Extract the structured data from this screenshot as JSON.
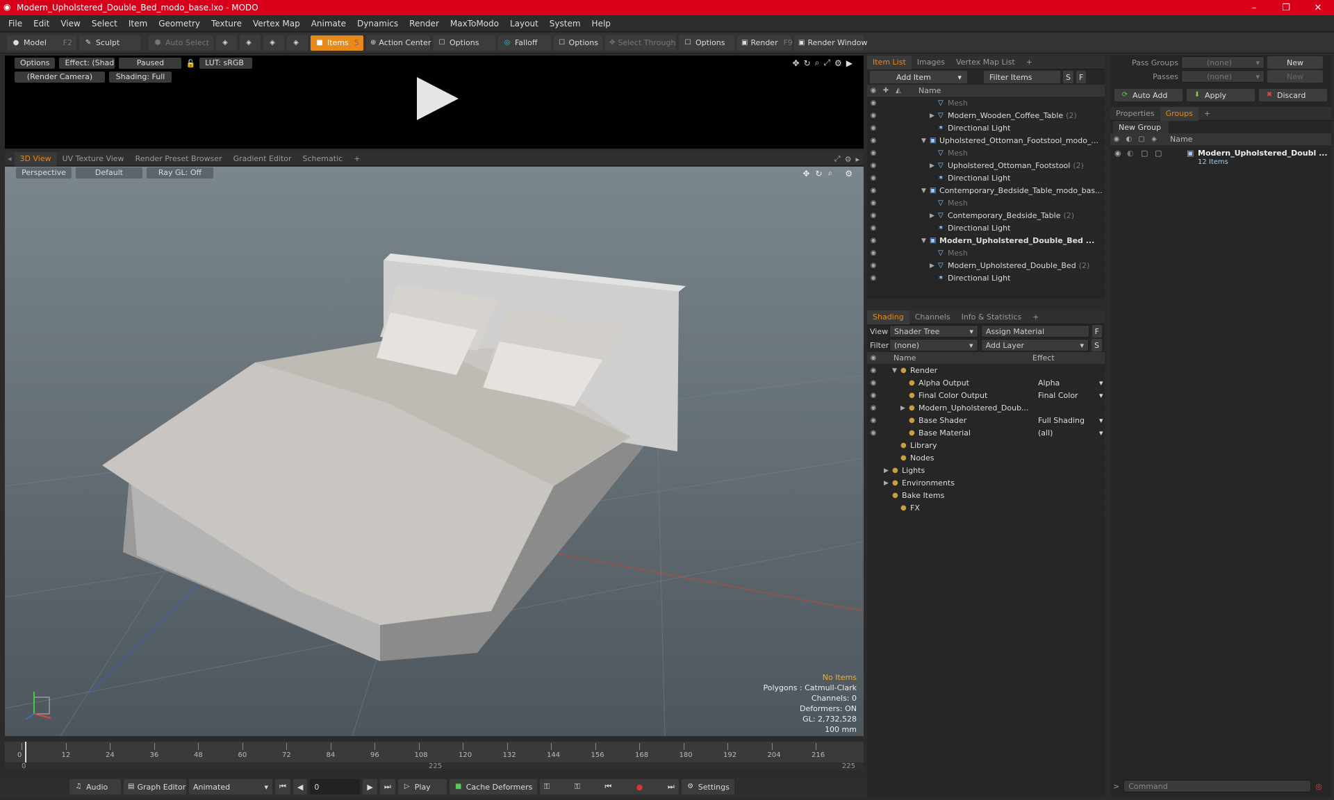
{
  "window": {
    "title": "Modern_Upholstered_Double_Bed_modo_base.lxo - MODO",
    "minimize": "–",
    "maximize": "❐",
    "close": "✕"
  },
  "menu": [
    "File",
    "Edit",
    "View",
    "Select",
    "Item",
    "Geometry",
    "Texture",
    "Vertex Map",
    "Animate",
    "Dynamics",
    "Render",
    "MaxToModo",
    "Layout",
    "System",
    "Help"
  ],
  "toolbar": {
    "model": "Model",
    "model_key": "F2",
    "sculpt": "Sculpt",
    "auto_select": "Auto Select",
    "items": "Items",
    "items_key": "5",
    "action_center": "Action Center",
    "options1": "Options",
    "falloff": "Falloff",
    "options2": "Options",
    "select_through": "Select Through",
    "options3": "Options",
    "render": "Render",
    "render_key": "F9",
    "render_window": "Render Window"
  },
  "preview": {
    "options": "Options",
    "effect": "Effect: (Shadi...",
    "paused": "Paused",
    "lut": "LUT: sRGB",
    "camera": "(Render Camera)",
    "shading": "Shading: Full"
  },
  "viewtabs": [
    "3D View",
    "UV Texture View",
    "Render Preset Browser",
    "Gradient Editor",
    "Schematic",
    "+"
  ],
  "viewport": {
    "perspective": "Perspective",
    "default": "Default",
    "raygl": "Ray GL: Off",
    "info": {
      "no_items": "No Items",
      "polygons": "Polygons : Catmull-Clark",
      "channels": "Channels: 0",
      "deformers": "Deformers: ON",
      "gl": "GL: 2,732,528",
      "unit": "100 mm"
    }
  },
  "itemlist": {
    "tabs": [
      "Item List",
      "Images",
      "Vertex Map List",
      "+"
    ],
    "add_item": "Add Item",
    "filter": "Filter Items",
    "s": "S",
    "f": "F",
    "col_name": "Name",
    "rows": [
      {
        "indent": 3,
        "icon": "▽",
        "label": "Mesh",
        "gray": true,
        "arrow": ""
      },
      {
        "indent": 3,
        "icon": "▽",
        "label": "Modern_Wooden_Coffee_Table",
        "suffix": "(2)",
        "arrow": "▶"
      },
      {
        "indent": 3,
        "icon": "✶",
        "label": "Directional Light",
        "arrow": ""
      },
      {
        "indent": 2,
        "icon": "▣",
        "label": "Upholstered_Ottoman_Footstool_modo_...",
        "arrow": "▼"
      },
      {
        "indent": 3,
        "icon": "▽",
        "label": "Mesh",
        "gray": true,
        "arrow": ""
      },
      {
        "indent": 3,
        "icon": "▽",
        "label": "Upholstered_Ottoman_Footstool",
        "suffix": "(2)",
        "arrow": "▶"
      },
      {
        "indent": 3,
        "icon": "✶",
        "label": "Directional Light",
        "arrow": ""
      },
      {
        "indent": 2,
        "icon": "▣",
        "label": "Contemporary_Bedside_Table_modo_bas...",
        "arrow": "▼"
      },
      {
        "indent": 3,
        "icon": "▽",
        "label": "Mesh",
        "gray": true,
        "arrow": ""
      },
      {
        "indent": 3,
        "icon": "▽",
        "label": "Contemporary_Bedside_Table",
        "suffix": "(2)",
        "arrow": "▶"
      },
      {
        "indent": 3,
        "icon": "✶",
        "label": "Directional Light",
        "arrow": ""
      },
      {
        "indent": 2,
        "icon": "▣",
        "label": "Modern_Upholstered_Double_Bed ...",
        "bold": true,
        "arrow": "▼"
      },
      {
        "indent": 3,
        "icon": "▽",
        "label": "Mesh",
        "gray": true,
        "arrow": ""
      },
      {
        "indent": 3,
        "icon": "▽",
        "label": "Modern_Upholstered_Double_Bed",
        "suffix": "(2)",
        "arrow": "▶"
      },
      {
        "indent": 3,
        "icon": "✶",
        "label": "Directional Light",
        "arrow": ""
      }
    ]
  },
  "shading": {
    "tabs": [
      "Shading",
      "Channels",
      "Info & Statistics",
      "+"
    ],
    "view_label": "View",
    "view_value": "Shader Tree",
    "assign": "Assign Material",
    "f": "F",
    "filter_label": "Filter",
    "filter_value": "(none)",
    "add_layer": "Add Layer",
    "s": "S",
    "col_name": "Name",
    "col_effect": "Effect",
    "rows": [
      {
        "indent": 1,
        "arrow": "▼",
        "label": "Render",
        "effect": "",
        "eye": true
      },
      {
        "indent": 2,
        "arrow": "",
        "label": "Alpha Output",
        "effect": "Alpha",
        "eye": true
      },
      {
        "indent": 2,
        "arrow": "",
        "label": "Final Color Output",
        "effect": "Final Color",
        "eye": true
      },
      {
        "indent": 2,
        "arrow": "▶",
        "label": "Modern_Upholstered_Doub...",
        "effect": "",
        "eye": true
      },
      {
        "indent": 2,
        "arrow": "",
        "label": "Base Shader",
        "effect": "Full Shading",
        "eye": true
      },
      {
        "indent": 2,
        "arrow": "",
        "label": "Base Material",
        "effect": "(all)",
        "eye": true
      },
      {
        "indent": 1,
        "arrow": "",
        "label": "Library",
        "effect": "",
        "eye": false
      },
      {
        "indent": 1,
        "arrow": "",
        "label": "Nodes",
        "effect": "",
        "eye": false
      },
      {
        "indent": 0,
        "arrow": "▶",
        "label": "Lights",
        "effect": "",
        "eye": false
      },
      {
        "indent": 0,
        "arrow": "▶",
        "label": "Environments",
        "effect": "",
        "eye": false
      },
      {
        "indent": 0,
        "arrow": "",
        "label": "Bake Items",
        "effect": "",
        "eye": false
      },
      {
        "indent": 1,
        "arrow": "",
        "label": "FX",
        "effect": "",
        "eye": false
      }
    ]
  },
  "right": {
    "pass_groups": "Pass Groups",
    "passes": "Passes",
    "none": "(none)",
    "new": "New",
    "auto_add": "Auto Add",
    "apply": "Apply",
    "discard": "Discard",
    "tabs": [
      "Properties",
      "Groups",
      "+"
    ],
    "new_group": "New Group",
    "col_name": "Name",
    "group_name": "Modern_Upholstered_Doubl ...",
    "group_count": "12 Items"
  },
  "timeline": {
    "ticks": [
      "0",
      "12",
      "24",
      "36",
      "48",
      "60",
      "72",
      "84",
      "96",
      "108",
      "120",
      "132",
      "144",
      "156",
      "168",
      "180",
      "192",
      "204",
      "216"
    ],
    "start": "0",
    "mid": "225",
    "end": "225"
  },
  "bottom": {
    "audio": "Audio",
    "graph_editor": "Graph Editor",
    "animated": "Animated",
    "frame": "0",
    "play": "Play",
    "cache": "Cache Deformers",
    "settings": "Settings",
    "command": "Command"
  }
}
